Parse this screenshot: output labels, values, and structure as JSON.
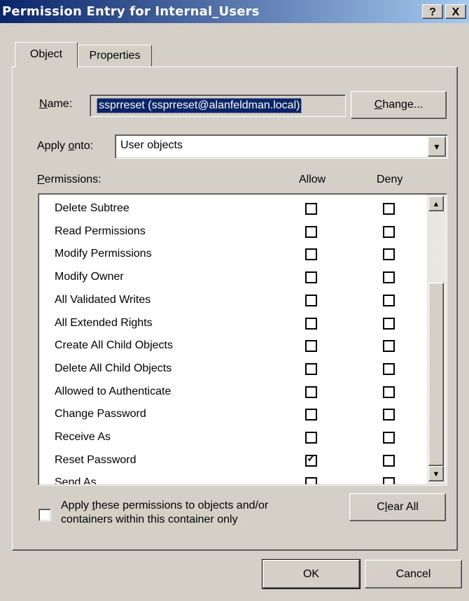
{
  "window": {
    "title": "Permission Entry for Internal_Users",
    "help_btn": "?",
    "close_btn": "X"
  },
  "tabs": [
    {
      "label": "Object"
    },
    {
      "label": "Properties"
    }
  ],
  "name": {
    "label_u": "N",
    "label_rest": "ame:",
    "value": "ssprreset (ssprreset@alanfeldman.local)",
    "change_u": "C",
    "change_rest": "hange..."
  },
  "apply_onto": {
    "label_pre": "Apply ",
    "label_u": "o",
    "label_rest": "nto:",
    "value": "User objects"
  },
  "permissions": {
    "label_u": "P",
    "label_rest": "ermissions:",
    "allow_header": "Allow",
    "deny_header": "Deny",
    "rows": [
      {
        "name": "Delete Subtree",
        "allow": false,
        "deny": false
      },
      {
        "name": "Read Permissions",
        "allow": false,
        "deny": false
      },
      {
        "name": "Modify Permissions",
        "allow": false,
        "deny": false
      },
      {
        "name": "Modify Owner",
        "allow": false,
        "deny": false
      },
      {
        "name": "All Validated Writes",
        "allow": false,
        "deny": false
      },
      {
        "name": "All Extended Rights",
        "allow": false,
        "deny": false
      },
      {
        "name": "Create All Child Objects",
        "allow": false,
        "deny": false
      },
      {
        "name": "Delete All Child Objects",
        "allow": false,
        "deny": false
      },
      {
        "name": "Allowed to Authenticate",
        "allow": false,
        "deny": false
      },
      {
        "name": "Change Password",
        "allow": false,
        "deny": false
      },
      {
        "name": "Receive As",
        "allow": false,
        "deny": false
      },
      {
        "name": "Reset Password",
        "allow": true,
        "deny": false
      },
      {
        "name": "Send As",
        "allow": false,
        "deny": false
      }
    ]
  },
  "apply_checkbox": {
    "checked": false,
    "line1_pre": "Apply ",
    "line1_u": "t",
    "line1_rest": "hese permissions to objects and/or",
    "line2": "containers within this container only"
  },
  "clear_all": {
    "pre": "C",
    "u": "l",
    "rest": "ear All"
  },
  "ok_label": "OK",
  "cancel_label": "Cancel"
}
